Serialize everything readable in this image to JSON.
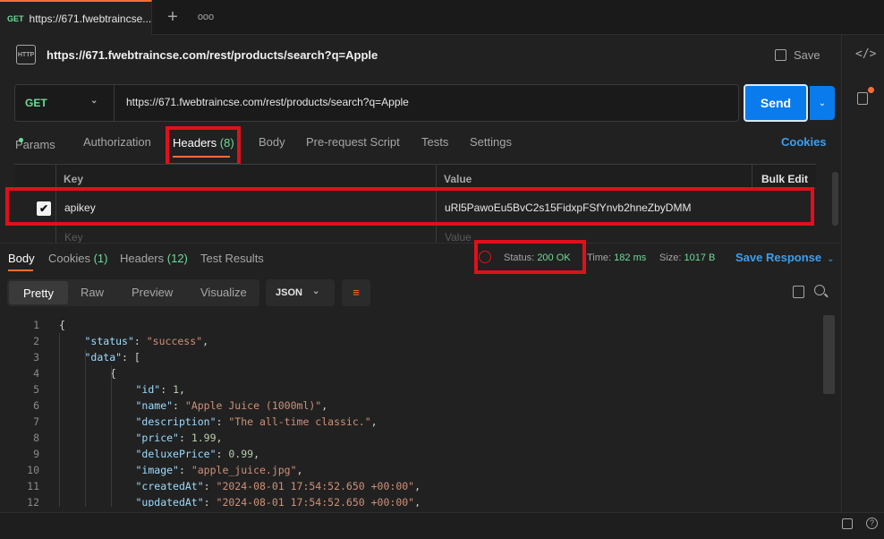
{
  "tab": {
    "method": "GET",
    "title": "https://671.fwebtraincse..."
  },
  "request": {
    "title_url": "https://671.fwebtraincse.com/rest/products/search?q=Apple",
    "save_label": "Save",
    "method": "GET",
    "url": "https://671.fwebtraincse.com/rest/products/search?q=Apple",
    "send_label": "Send"
  },
  "req_tabs": {
    "params": "Params",
    "authorization": "Authorization",
    "headers": "Headers",
    "headers_count": "(8)",
    "body": "Body",
    "prerequest": "Pre-request Script",
    "tests": "Tests",
    "settings": "Settings",
    "cookies": "Cookies"
  },
  "headers_table": {
    "col_key": "Key",
    "col_value": "Value",
    "bulk_edit": "Bulk Edit",
    "row_key": "apikey",
    "row_value": "uRl5PawoEu5BvC2s15FidxpFSfYnvb2hneZbyDMM",
    "placeholder_key": "Key",
    "placeholder_value": "Value"
  },
  "response_tabs": {
    "body": "Body",
    "cookies": "Cookies",
    "cookies_count": "(1)",
    "headers": "Headers",
    "headers_count": "(12)",
    "test_results": "Test Results"
  },
  "response_meta": {
    "status_label": "Status:",
    "status_value": "200 OK",
    "time_label": "Time:",
    "time_value": "182 ms",
    "size_label": "Size:",
    "size_value": "1017 B",
    "save_response": "Save Response"
  },
  "view_tabs": [
    "Pretty",
    "Raw",
    "Preview",
    "Visualize"
  ],
  "format": "JSON",
  "code_lines": [
    {
      "n": "1",
      "indent": 0,
      "parts": [
        [
          "p",
          "{"
        ]
      ]
    },
    {
      "n": "2",
      "indent": 1,
      "parts": [
        [
          "k",
          "\"status\""
        ],
        [
          "p",
          ": "
        ],
        [
          "s",
          "\"success\""
        ],
        [
          "p",
          ","
        ]
      ]
    },
    {
      "n": "3",
      "indent": 1,
      "parts": [
        [
          "k",
          "\"data\""
        ],
        [
          "p",
          ": ["
        ]
      ]
    },
    {
      "n": "4",
      "indent": 2,
      "parts": [
        [
          "p",
          "{"
        ]
      ]
    },
    {
      "n": "5",
      "indent": 3,
      "parts": [
        [
          "k",
          "\"id\""
        ],
        [
          "p",
          ": "
        ],
        [
          "n",
          "1"
        ],
        [
          "p",
          ","
        ]
      ]
    },
    {
      "n": "6",
      "indent": 3,
      "parts": [
        [
          "k",
          "\"name\""
        ],
        [
          "p",
          ": "
        ],
        [
          "s",
          "\"Apple Juice (1000ml)\""
        ],
        [
          "p",
          ","
        ]
      ]
    },
    {
      "n": "7",
      "indent": 3,
      "parts": [
        [
          "k",
          "\"description\""
        ],
        [
          "p",
          ": "
        ],
        [
          "s",
          "\"The all-time classic.\""
        ],
        [
          "p",
          ","
        ]
      ]
    },
    {
      "n": "8",
      "indent": 3,
      "parts": [
        [
          "k",
          "\"price\""
        ],
        [
          "p",
          ": "
        ],
        [
          "n",
          "1.99"
        ],
        [
          "p",
          ","
        ]
      ]
    },
    {
      "n": "9",
      "indent": 3,
      "parts": [
        [
          "k",
          "\"deluxePrice\""
        ],
        [
          "p",
          ": "
        ],
        [
          "n",
          "0.99"
        ],
        [
          "p",
          ","
        ]
      ]
    },
    {
      "n": "10",
      "indent": 3,
      "parts": [
        [
          "k",
          "\"image\""
        ],
        [
          "p",
          ": "
        ],
        [
          "s",
          "\"apple_juice.jpg\""
        ],
        [
          "p",
          ","
        ]
      ]
    },
    {
      "n": "11",
      "indent": 3,
      "parts": [
        [
          "k",
          "\"createdAt\""
        ],
        [
          "p",
          ": "
        ],
        [
          "s",
          "\"2024-08-01 17:54:52.650 +00:00\""
        ],
        [
          "p",
          ","
        ]
      ]
    },
    {
      "n": "12",
      "indent": 3,
      "parts": [
        [
          "k",
          "\"updatedAt\""
        ],
        [
          "p",
          ": "
        ],
        [
          "s",
          "\"2024-08-01 17:54:52.650 +00:00\""
        ],
        [
          "p",
          ","
        ]
      ]
    }
  ],
  "icons": {
    "http": "HTTP",
    "checkmark": "✔",
    "plus": "+",
    "more": "ooo",
    "chevron": "⌄",
    "code": "</>"
  },
  "colors": {
    "accent": "#ff6c37",
    "send": "#097bed",
    "highlight": "#e0101b",
    "success": "#6bdd9a"
  }
}
